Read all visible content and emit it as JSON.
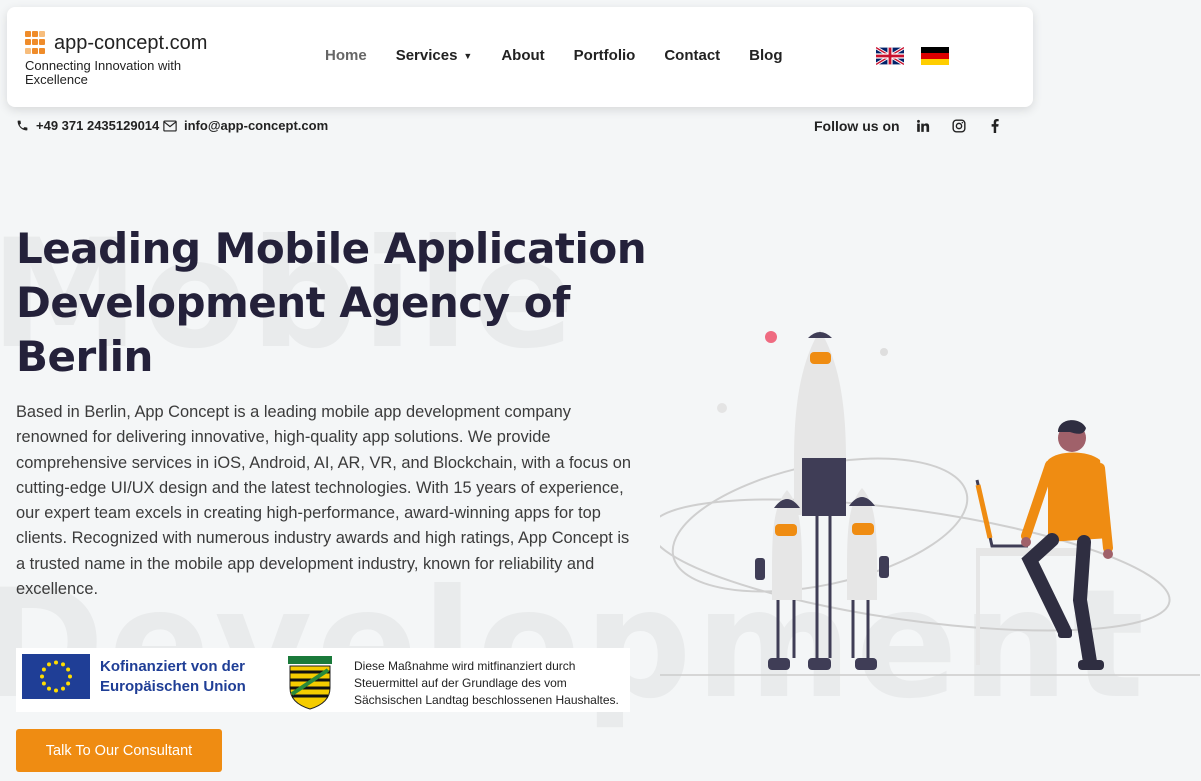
{
  "watermark": {
    "line1": "Mobile",
    "line2": "Development"
  },
  "header": {
    "logo_name": "app-concept.com",
    "logo_tagline": "Connecting Innovation with Excellence",
    "nav": [
      {
        "label": "Home",
        "active": true
      },
      {
        "label": "Services",
        "has_dropdown": true
      },
      {
        "label": "About"
      },
      {
        "label": "Portfolio"
      },
      {
        "label": "Contact"
      },
      {
        "label": "Blog"
      }
    ],
    "languages": [
      {
        "flag": "uk-flag"
      },
      {
        "flag": "germany-flag"
      }
    ]
  },
  "contact": {
    "phone": "+49 371 2435129014",
    "email": "info@app-concept.com",
    "follow_label": "Follow us on",
    "socials": [
      "linkedin-icon",
      "instagram-icon",
      "facebook-icon"
    ]
  },
  "hero": {
    "title": "Leading Mobile Application Development Agency of Berlin",
    "description": "Based in Berlin, App Concept is a leading mobile app development company renowned for delivering innovative, high-quality app solutions. We provide comprehensive services in iOS, Android, AI, AR, VR, and Blockchain, with a focus on cutting-edge UI/UX design and the latest technologies. With 15 years of experience, our expert team excels in creating high-performance, award-winning apps for top clients. Recognized with numerous industry awards and high ratings, App Concept is a trusted name in the mobile app development industry, known for reliability and excellence.",
    "cta_label": "Talk To Our Consultant"
  },
  "funding": {
    "eu_line1": "Kofinanziert von der",
    "eu_line2": "Europäischen Union",
    "saxony_line1": "Diese Maßnahme wird mitfinanziert durch",
    "saxony_line2": "Steuermittel auf der Grundlage des vom",
    "saxony_line3": "Sächsischen Landtag beschlossenen Haushaltes."
  },
  "colors": {
    "accent": "#ef8c12",
    "title": "#24213a",
    "eu_blue": "#1f3e96",
    "background": "#f4f6f7"
  }
}
